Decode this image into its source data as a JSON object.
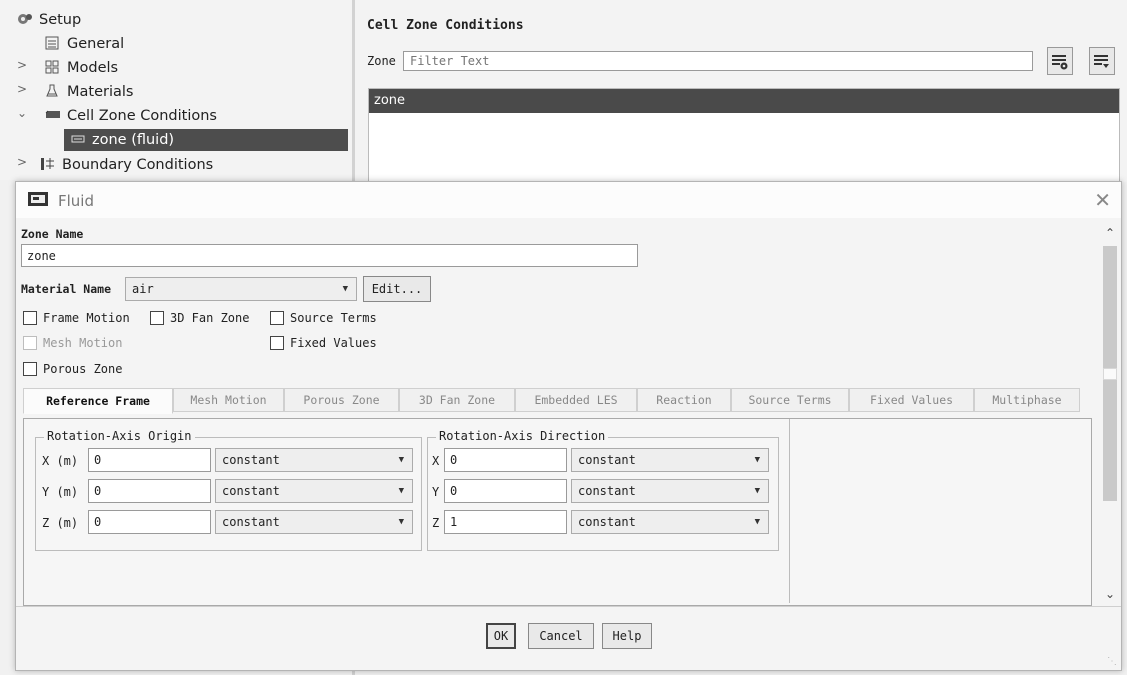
{
  "tree": {
    "root": "Setup",
    "items": [
      {
        "label": "General",
        "icon": "list-icon",
        "expandable": false
      },
      {
        "label": "Models",
        "icon": "models-icon",
        "expandable": true
      },
      {
        "label": "Materials",
        "icon": "flask-icon",
        "expandable": true
      },
      {
        "label": "Cell Zone Conditions",
        "icon": "cell-zone-icon",
        "expandable": true,
        "expanded": true
      },
      {
        "label": "zone (fluid)",
        "icon": "zone-icon",
        "selected": true
      },
      {
        "label": "Boundary Conditions",
        "icon": "boundary-icon",
        "expandable": true
      }
    ]
  },
  "cell_zone_panel": {
    "title": "Cell Zone Conditions",
    "zone_label": "Zone",
    "filter_placeholder": "Filter Text",
    "zones": [
      "zone"
    ]
  },
  "dialog": {
    "title": "Fluid",
    "zone_name_label": "Zone Name",
    "zone_name_value": "zone",
    "material_name_label": "Material Name",
    "material_value": "air",
    "edit_button": "Edit...",
    "checkboxes": {
      "frame_motion": {
        "label": "Frame Motion",
        "checked": false,
        "enabled": true
      },
      "fan_zone_3d": {
        "label": "3D Fan Zone",
        "checked": false,
        "enabled": true
      },
      "source_terms": {
        "label": "Source Terms",
        "checked": false,
        "enabled": true
      },
      "mesh_motion": {
        "label": "Mesh Motion",
        "checked": false,
        "enabled": false
      },
      "fixed_values": {
        "label": "Fixed Values",
        "checked": false,
        "enabled": true
      },
      "porous_zone": {
        "label": "Porous Zone",
        "checked": false,
        "enabled": true
      }
    },
    "tabs": [
      "Reference Frame",
      "Mesh Motion",
      "Porous Zone",
      "3D Fan Zone",
      "Embedded LES",
      "Reaction",
      "Source Terms",
      "Fixed Values",
      "Multiphase"
    ],
    "active_tab": "Reference Frame",
    "origin_group": {
      "title": "Rotation-Axis Origin",
      "rows": [
        {
          "label": "X (m)",
          "value": "0",
          "method": "constant"
        },
        {
          "label": "Y (m)",
          "value": "0",
          "method": "constant"
        },
        {
          "label": "Z (m)",
          "value": "0",
          "method": "constant"
        }
      ]
    },
    "direction_group": {
      "title": "Rotation-Axis Direction",
      "rows": [
        {
          "label": "X",
          "value": "0",
          "method": "constant"
        },
        {
          "label": "Y",
          "value": "0",
          "method": "constant"
        },
        {
          "label": "Z",
          "value": "1",
          "method": "constant"
        }
      ]
    },
    "buttons": {
      "ok": "OK",
      "cancel": "Cancel",
      "help": "Help"
    }
  },
  "colors": {
    "selection": "#4d4d4d",
    "dialog_bg": "#f4f4f4"
  }
}
